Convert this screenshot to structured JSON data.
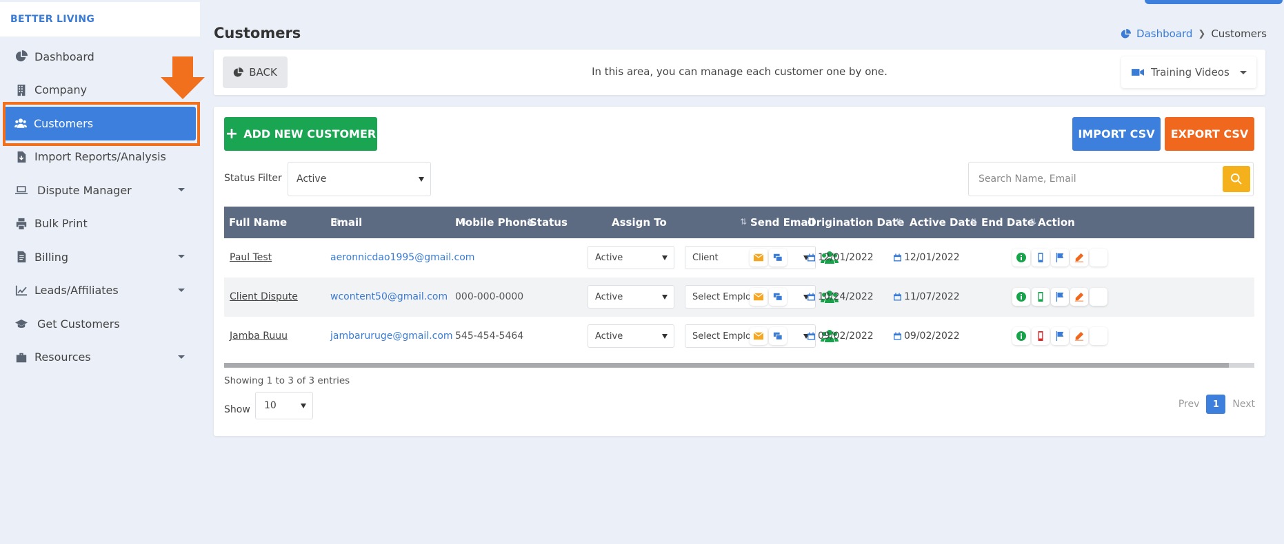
{
  "brand": "BETTER LIVING",
  "sidebar": {
    "items": [
      {
        "label": "Dashboard",
        "icon": "chart-pie-icon"
      },
      {
        "label": "Company",
        "icon": "building-icon"
      },
      {
        "label": "Customers",
        "icon": "users-icon",
        "active": true
      },
      {
        "label": "Import Reports/Analysis",
        "icon": "file-import-icon"
      },
      {
        "label": "Dispute Manager",
        "icon": "laptop-icon",
        "has_submenu": true
      },
      {
        "label": "Bulk Print",
        "icon": "print-icon"
      },
      {
        "label": "Billing",
        "icon": "invoice-icon",
        "has_submenu": true
      },
      {
        "label": "Leads/Affiliates",
        "icon": "chart-line-icon",
        "has_submenu": true
      },
      {
        "label": "Get Customers",
        "icon": "graduation-cap-icon"
      },
      {
        "label": "Resources",
        "icon": "briefcase-icon",
        "has_submenu": true
      }
    ]
  },
  "header": {
    "title": "Customers",
    "breadcrumb": {
      "home": "Dashboard",
      "current": "Customers"
    }
  },
  "info_bar": {
    "back_label": "BACK",
    "text": "In this area, you can manage each customer one by one.",
    "training_label": "Training Videos"
  },
  "toolbar": {
    "add_label": "ADD NEW CUSTOMER",
    "import_label": "IMPORT CSV",
    "export_label": "EXPORT CSV",
    "status_filter_label": "Status Filter",
    "status_filter_value": "Active",
    "search_placeholder": "Search Name, Email"
  },
  "table": {
    "columns": [
      "Full Name",
      "Email",
      "Mobile Phone",
      "Status",
      "Assign To",
      "Send Email",
      "Origination Date",
      "Active Date",
      "End Date",
      "Action"
    ],
    "rows": [
      {
        "name": "Paul Test",
        "email": "aeronnicdao1995@gmail.com",
        "phone": "",
        "status": "Active",
        "assign": "Client",
        "origination": "12/01/2022",
        "active_date": "12/01/2022",
        "end_date": "",
        "phone_icon_color": "#3a7bd5"
      },
      {
        "name": "Client Dispute",
        "email": "wcontent50@gmail.com",
        "phone": "000-000-0000",
        "status": "Active",
        "assign": "Select Employee",
        "origination": "10/24/2022",
        "active_date": "11/07/2022",
        "end_date": "",
        "phone_icon_color": "#17a34a"
      },
      {
        "name": "Jamba Ruuu",
        "email": "jambaruruge@gmail.com",
        "phone": "545-454-5464",
        "status": "Active",
        "assign": "Select Employee",
        "origination": "09/02/2022",
        "active_date": "09/02/2022",
        "end_date": "",
        "phone_icon_color": "#e02424"
      }
    ]
  },
  "footer": {
    "showing": "Showing 1 to 3 of 3 entries",
    "show_label": "Show",
    "page_size": "10",
    "prev": "Prev",
    "page": "1",
    "next": "Next"
  },
  "colors": {
    "primary": "#3c7fdc",
    "success": "#1aa553",
    "export": "#f0671e",
    "search": "#f5b11c",
    "highlight": "#f0701e",
    "table_header": "#5d6b82"
  }
}
